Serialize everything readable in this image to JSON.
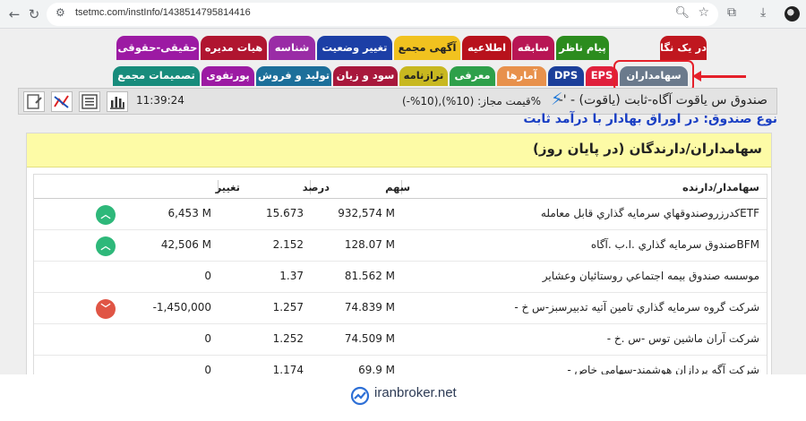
{
  "browser": {
    "url": "tsetmc.com/instInfo/1438514795814416"
  },
  "tabs_row1": [
    {
      "label": "در یک نگاه",
      "color": "#c0171f"
    },
    {
      "label": "پیام ناظر",
      "color": "#2c8c1e"
    },
    {
      "label": "سابقه",
      "color": "#b81654"
    },
    {
      "label": "اطلاعیه",
      "color": "#b8121c"
    },
    {
      "label": "آگهی مجمع",
      "color": "#f1c21f"
    },
    {
      "label": "تغییر وضعیت",
      "color": "#1c3fa6"
    },
    {
      "label": "شناسه",
      "color": "#9a2ca6"
    },
    {
      "label": "هیات مدیره",
      "color": "#b01530"
    },
    {
      "label": "حقیقی-حقوقی",
      "color": "#9c1aa3"
    }
  ],
  "tabs_row2": [
    {
      "label": "سهامداران",
      "color": "#6b7a8c"
    },
    {
      "label": "EPS",
      "color": "#e0203c"
    },
    {
      "label": "DPS",
      "color": "#1c3f9a"
    },
    {
      "label": "آمارها",
      "color": "#e8914c"
    },
    {
      "label": "معرفی",
      "color": "#2ea04a"
    },
    {
      "label": "ترازنامه",
      "color": "#c8b820"
    },
    {
      "label": "سود و زیان",
      "color": "#a8183c"
    },
    {
      "label": "تولید و فروش",
      "color": "#1c6f9a"
    },
    {
      "label": "پورتفوی",
      "color": "#9c1aa3"
    },
    {
      "label": "تصمیمات مجمع",
      "color": "#188c7c"
    }
  ],
  "header": {
    "clock": "11:39:24",
    "fund_name": "صندوق س ياقوت آگاه-ثابت (ياقوت) - '-",
    "price_limit": "%قیمت مجاز: (10%),(10%-)"
  },
  "subtitle": "نوع صندوق: در اوراق بهادار با درآمد ثابت",
  "panel": {
    "title": "سهامداران/دارندگان (در پایان روز)",
    "columns": {
      "holder": "سهامدار/دارنده",
      "shares": "سهم",
      "percent": "درصد",
      "change": "تغییر"
    },
    "rows": [
      {
        "name": "ETFکدرزروصندوقهاي سرمايه گذاري قابل معامله",
        "shares": "932,574 M",
        "percent": "15.673",
        "change": "6,453 M",
        "trend": "up",
        "trend_icon": "chevron-up-icon"
      },
      {
        "name": "BFMصندوق سرمايه گذاري .ا.ب .آگاه",
        "shares": "128.07 M",
        "percent": "2.152",
        "change": "42,506 M",
        "trend": "up",
        "trend_icon": "chevron-up-icon"
      },
      {
        "name": "موسسه صندوق بيمه اجتماعي روستائيان وعشاير",
        "shares": "81.562 M",
        "percent": "1.37",
        "change": "0",
        "trend": "none"
      },
      {
        "name": "شركت گروه سرمايه گذاري تامين آتيه تدبيرسبز-س خ -",
        "shares": "74.839 M",
        "percent": "1.257",
        "change": "-1,450,000",
        "trend": "down",
        "trend_icon": "chevron-down-icon"
      },
      {
        "name": "شركت آران ماشين توس -س .خ -",
        "shares": "74.509 M",
        "percent": "1.252",
        "change": "0",
        "trend": "none"
      },
      {
        "name": "شركت آگه پردازان هوشمند-سهامي خاص -",
        "shares": "69.9 M",
        "percent": "1.174",
        "change": "0",
        "trend": "none"
      }
    ]
  },
  "footer": {
    "site": "iranbroker.net"
  }
}
